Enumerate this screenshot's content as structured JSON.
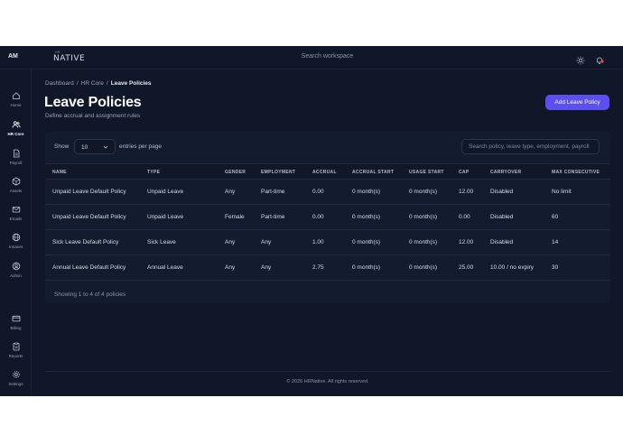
{
  "topbar": {
    "avatar_initials": "AM",
    "logo_small": "HR",
    "logo_text": "NATIVE",
    "search_placeholder": "Search workspace",
    "notification_dot_color": "#e5484d"
  },
  "sidebar": {
    "items": [
      {
        "label": "Home",
        "icon": "home-icon"
      },
      {
        "label": "HR Core",
        "icon": "users-icon",
        "active": true
      },
      {
        "label": "Payroll",
        "icon": "document-icon"
      },
      {
        "label": "Assets",
        "icon": "box-icon"
      },
      {
        "label": "Emails",
        "icon": "mail-icon"
      },
      {
        "label": "Intranet",
        "icon": "globe-icon"
      },
      {
        "label": "Admin",
        "icon": "admin-icon"
      },
      {
        "label": "Billing",
        "icon": "card-icon"
      },
      {
        "label": "Reports",
        "icon": "report-icon"
      },
      {
        "label": "Settings",
        "icon": "gear-icon"
      }
    ]
  },
  "breadcrumb": [
    "Dashboard",
    "HR Core",
    "Leave Policies"
  ],
  "page": {
    "title": "Leave Policies",
    "subtitle": "Define accrual and assignment rules",
    "add_button": "Add Leave Policy"
  },
  "table_controls": {
    "show_label": "Show",
    "page_size": "10",
    "per_page_label": "entries per page",
    "search_placeholder": "Search policy, leave type, employment, payroll"
  },
  "table": {
    "columns": [
      "NAME",
      "TYPE",
      "GENDER",
      "EMPLOYMENT",
      "ACCRUAL",
      "ACCRUAL START",
      "USAGE START",
      "CAP",
      "CARRYOVER",
      "MAX CONSECUTIVE"
    ],
    "rows": [
      [
        "Unpaid Leave Default Policy",
        "Unpaid Leave",
        "Any",
        "Part-time",
        "0.00",
        "0 month(s)",
        "0 month(s)",
        "12.00",
        "Disabled",
        "No limit"
      ],
      [
        "Unpaid Leave Default Policy",
        "Unpaid Leave",
        "Female",
        "Part-time",
        "0.00",
        "0 month(s)",
        "0 month(s)",
        "0.00",
        "Disabled",
        "60"
      ],
      [
        "Sick Leave Default Policy",
        "Sick Leave",
        "Any",
        "Any",
        "1.00",
        "0 month(s)",
        "0 month(s)",
        "12.00",
        "Disabled",
        "14"
      ],
      [
        "Annual Leave Default Policy",
        "Annual Leave",
        "Any",
        "Any",
        "2.75",
        "0 month(s)",
        "0 month(s)",
        "25.00",
        "10.00 / no expiry",
        "30"
      ]
    ],
    "summary": "Showing 1 to 4 of 4 policies"
  },
  "footer": {
    "copyright": "© 2026 HRNative. All rights reserved."
  },
  "colors": {
    "background": "#0f1729",
    "card": "#131c2f",
    "accent": "#5b4ff0"
  }
}
